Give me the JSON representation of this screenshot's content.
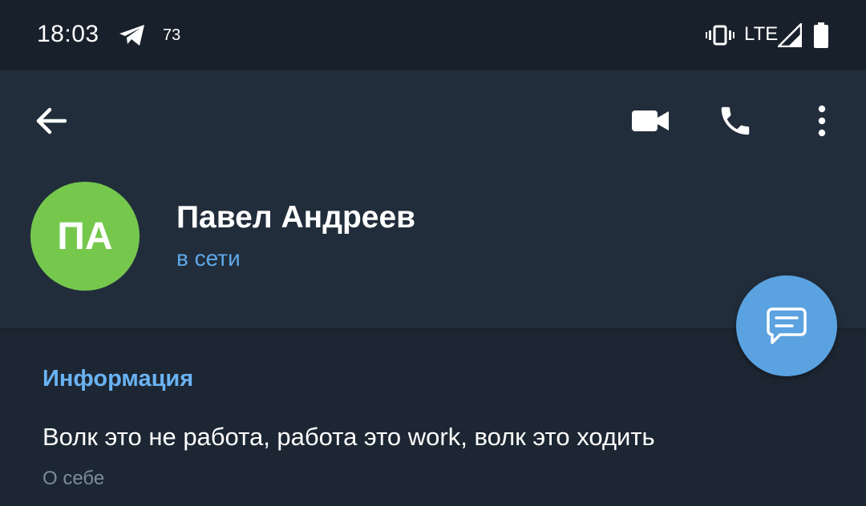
{
  "status_bar": {
    "time": "18:03",
    "notification_count": "73",
    "network": "LTE",
    "icons": [
      "telegram-icon",
      "vibrate-icon",
      "signal-icon",
      "battery-icon"
    ]
  },
  "toolbar": {
    "icons": [
      "back-arrow-icon",
      "video-camera-icon",
      "phone-icon",
      "more-vert-icon"
    ]
  },
  "profile": {
    "initials": "ПА",
    "name": "Павел Андреев",
    "status": "в сети",
    "avatar_color": "#76c84d"
  },
  "info": {
    "section_title": "Информация",
    "bio": "Волк это не работа, работа это work, волк это ходить",
    "bio_label": "О себе"
  },
  "fab": {
    "icon": "message-icon"
  },
  "colors": {
    "status_bar_bg": "#18212b",
    "header_bg": "#212d3b",
    "body_bg": "#1d2733",
    "accent": "#6ab3f3",
    "fab_bg": "#5aa2e0",
    "secondary_text": "#7d8b99"
  }
}
